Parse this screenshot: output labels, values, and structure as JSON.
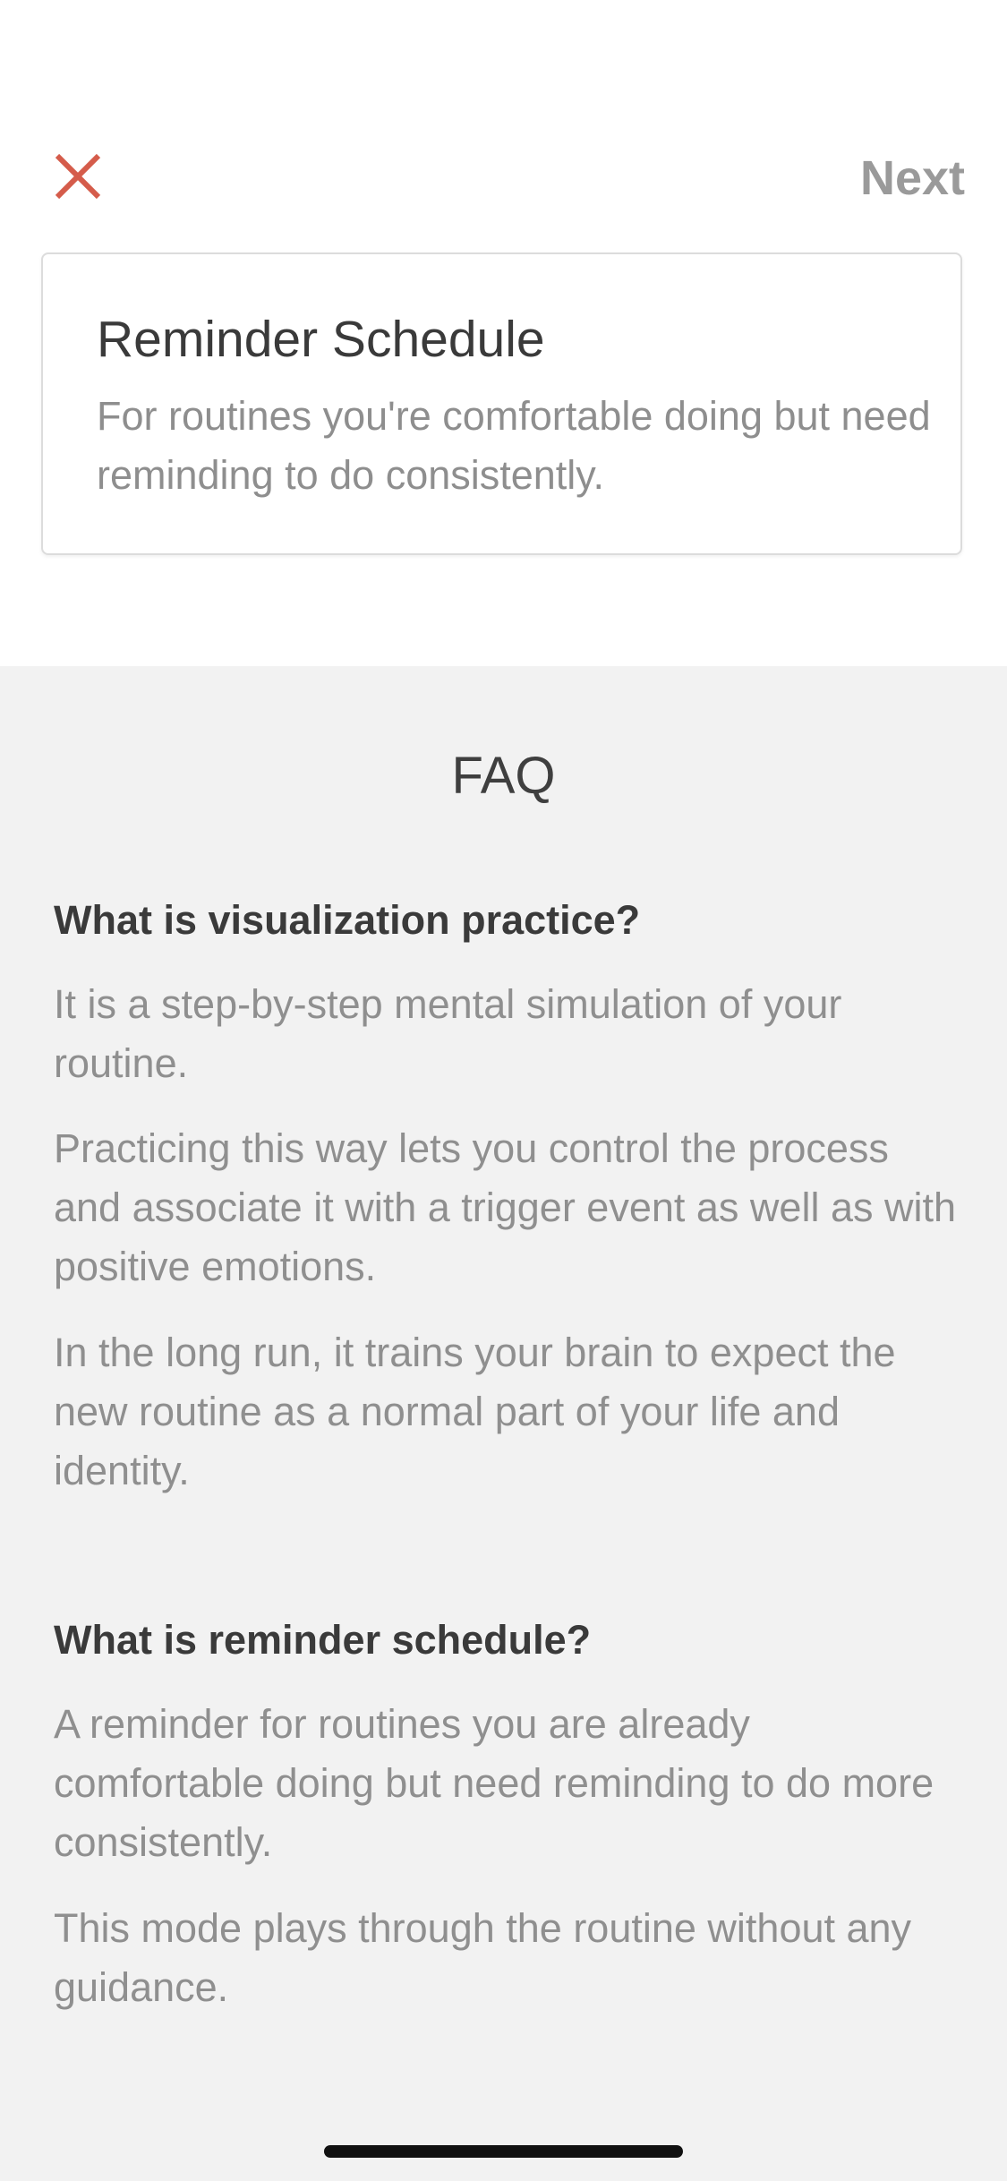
{
  "header": {
    "close_icon": "close-icon",
    "close_color": "#d55c4b",
    "next_label": "Next"
  },
  "card": {
    "title": "Reminder Schedule",
    "description": "For routines you're comfortable doing but need reminding to do consistently."
  },
  "faq": {
    "title": "FAQ",
    "items": [
      {
        "question": "What is visualization practice?",
        "answers": [
          "It is a step-by-step mental simulation of your routine.",
          "Practicing this way lets you control the process and associate it with a trigger event as well as with positive emotions.",
          "In the long run, it trains your brain to expect the new routine as a normal part of your life and identity."
        ]
      },
      {
        "question": "What is reminder schedule?",
        "answers": [
          "A reminder for routines you are already comfortable doing but need reminding to do more consistently.",
          "This mode plays through the routine without any guidance."
        ]
      }
    ]
  }
}
